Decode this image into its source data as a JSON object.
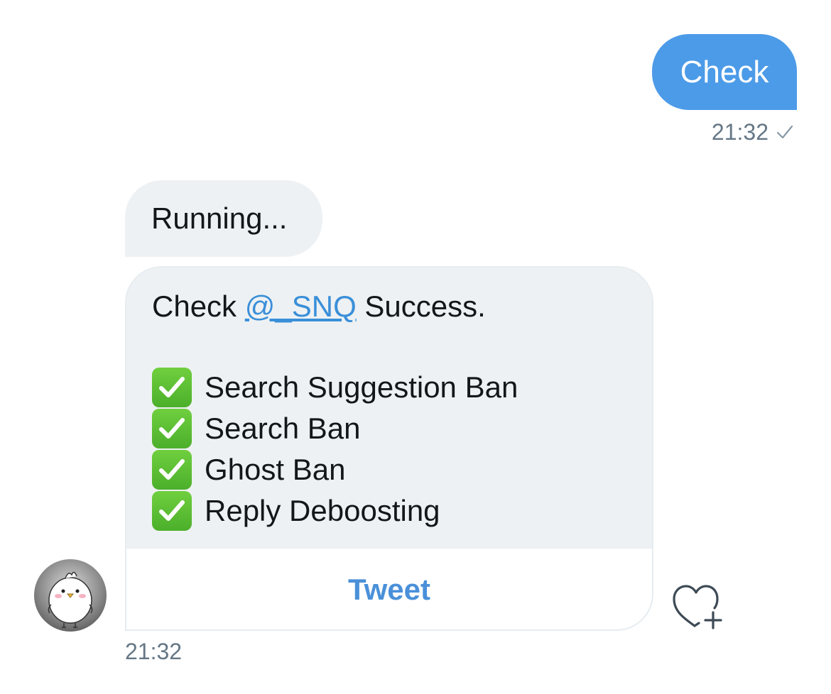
{
  "outgoing": {
    "text": "Check",
    "time": "21:32",
    "status_icon": "sent-check-icon"
  },
  "incoming": {
    "status_text": "Running...",
    "result": {
      "prefix": "Check",
      "mention": "@_SNQ",
      "suffix": "Success.",
      "checks": [
        {
          "icon": "white-check-mark-emoji",
          "label": "Search Suggestion Ban"
        },
        {
          "icon": "white-check-mark-emoji",
          "label": "Search Ban"
        },
        {
          "icon": "white-check-mark-emoji",
          "label": "Ghost Ban"
        },
        {
          "icon": "white-check-mark-emoji",
          "label": "Reply Deboosting"
        }
      ],
      "action_label": "Tweet"
    },
    "time": "21:32",
    "avatar_icon": "bird-avatar",
    "react_icon": "heart-plus-icon"
  },
  "colors": {
    "outgoing_bubble": "#4c9be8",
    "incoming_bubble": "#eef1f3",
    "link": "#3a8fd9",
    "meta_text": "#657786",
    "check_green": "#5cbf32"
  }
}
